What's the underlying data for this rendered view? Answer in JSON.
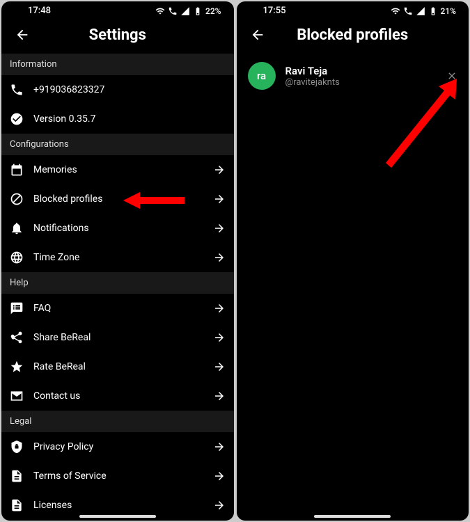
{
  "left": {
    "status_time": "17:48",
    "status_battery": "22%",
    "title": "Settings",
    "sections": {
      "information": {
        "header": "Information",
        "phone": "+919036823327",
        "version": "Version 0.35.7"
      },
      "configurations": {
        "header": "Configurations",
        "memories": "Memories",
        "blocked": "Blocked profiles",
        "notifications": "Notifications",
        "timezone": "Time Zone"
      },
      "help": {
        "header": "Help",
        "faq": "FAQ",
        "share": "Share BeReal",
        "rate": "Rate BeReal",
        "contact": "Contact us"
      },
      "legal": {
        "header": "Legal",
        "privacy": "Privacy Policy",
        "terms": "Terms of Service",
        "licenses": "Licenses"
      }
    }
  },
  "right": {
    "status_time": "17:55",
    "status_battery": "21%",
    "title": "Blocked profiles",
    "profile": {
      "avatar": "ra",
      "name": "Ravi Teja",
      "handle": "@ravitejaknts"
    }
  }
}
